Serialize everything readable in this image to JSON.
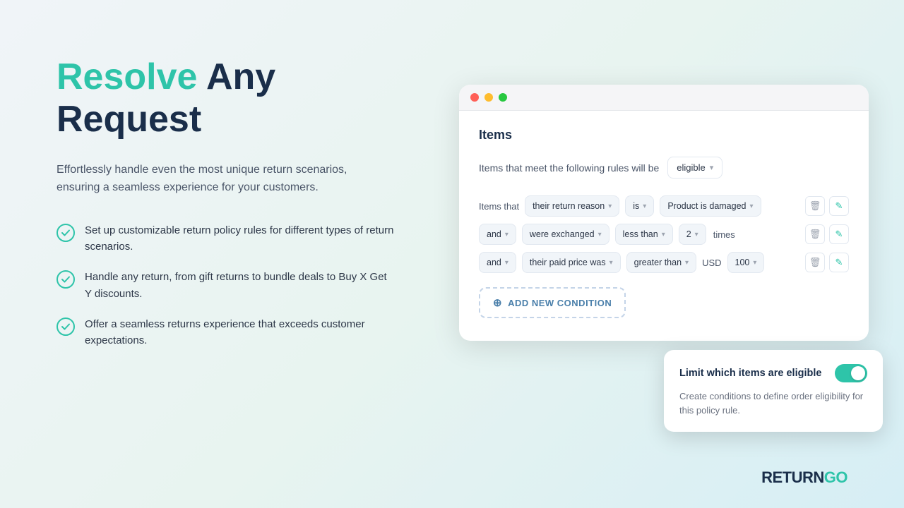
{
  "left": {
    "headline_green": "Resolve",
    "headline_dark": " Any\nRequest",
    "subtitle": "Effortlessly handle even the most unique return scenarios, ensuring a seamless experience for your customers.",
    "features": [
      {
        "text": "Set up customizable return policy rules for different types of return scenarios."
      },
      {
        "text": "Handle any return, from gift returns to bundle deals to Buy X Get Y discounts."
      },
      {
        "text": "Offer a seamless returns experience that exceeds customer expectations."
      }
    ]
  },
  "browser": {
    "section_title": "Items",
    "eligibility_label": "Items that meet the following rules will be",
    "eligibility_value": "eligible",
    "conditions": [
      {
        "prefix": "Items that",
        "field": "their return reason",
        "operator": "is",
        "value": "Product is damaged"
      },
      {
        "prefix": "and",
        "field": "were exchanged",
        "operator": "less than",
        "value": "2",
        "suffix": "times"
      },
      {
        "prefix": "and",
        "field": "their paid price was",
        "operator": "greater than",
        "currency": "USD",
        "value": "100"
      }
    ],
    "add_condition_label": "ADD NEW CONDITION"
  },
  "tooltip": {
    "title": "Limit which items are eligible",
    "description": "Create conditions to define order eligibility for this policy rule.",
    "toggle_on": true
  },
  "logo": {
    "text_dark": "RETURN",
    "text_green": "GO"
  }
}
